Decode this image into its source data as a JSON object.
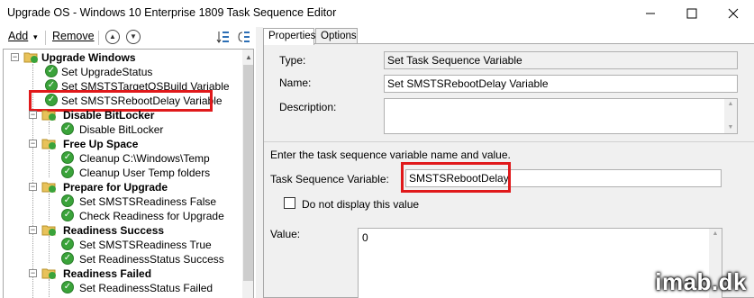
{
  "window": {
    "title": "Upgrade OS - Windows 10 Enterprise 1809 Task Sequence Editor",
    "minimize_icon": "minimize-icon",
    "maximize_icon": "maximize-icon",
    "close_icon": "close-icon"
  },
  "toolbar": {
    "add_label": "Add",
    "add_arrow": "▾",
    "remove_label": "Remove",
    "move_up_icon": "move-up-icon",
    "move_down_icon": "move-down-icon"
  },
  "tree": {
    "items": [
      {
        "label": "Upgrade Windows",
        "type": "group",
        "level": 0
      },
      {
        "label": "Set UpgradeStatus",
        "type": "step",
        "level": 1
      },
      {
        "label": "Set SMSTSTargetOSBuild Variable",
        "type": "step",
        "level": 1
      },
      {
        "label": "Set SMSTSRebootDelay Variable",
        "type": "step",
        "level": 1,
        "selected": true
      },
      {
        "label": "Disable BitLocker",
        "type": "group",
        "level": 1
      },
      {
        "label": "Disable BitLocker",
        "type": "step",
        "level": 2
      },
      {
        "label": "Free Up Space",
        "type": "group",
        "level": 1
      },
      {
        "label": "Cleanup C:\\Windows\\Temp",
        "type": "step",
        "level": 2
      },
      {
        "label": "Cleanup User Temp folders",
        "type": "step",
        "level": 2
      },
      {
        "label": "Prepare for Upgrade",
        "type": "group",
        "level": 1
      },
      {
        "label": "Set SMSTSReadiness False",
        "type": "step",
        "level": 2
      },
      {
        "label": "Check Readiness for Upgrade",
        "type": "step",
        "level": 2
      },
      {
        "label": "Readiness Success",
        "type": "group",
        "level": 1
      },
      {
        "label": "Set SMSTSReadiness True",
        "type": "step",
        "level": 2
      },
      {
        "label": "Set ReadinessStatus Success",
        "type": "step",
        "level": 2
      },
      {
        "label": "Readiness Failed",
        "type": "group",
        "level": 1
      },
      {
        "label": "Set ReadinessStatus Failed",
        "type": "step",
        "level": 2
      }
    ]
  },
  "tabs": [
    {
      "label": "Properties",
      "active": true
    },
    {
      "label": "Options",
      "active": false
    }
  ],
  "properties": {
    "type_label": "Type:",
    "type_value": "Set Task Sequence Variable",
    "name_label": "Name:",
    "name_value": "Set SMSTSRebootDelay Variable",
    "description_label": "Description:",
    "description_value": "",
    "instruction": "Enter the task sequence variable name and value.",
    "variable_label": "Task Sequence Variable:",
    "variable_value": "SMSTSRebootDelay",
    "hide_checkbox_label": "Do not display this value",
    "hide_checkbox_checked": false,
    "value_label": "Value:",
    "value_value": "0"
  },
  "watermark": "imab.dk",
  "colors": {
    "highlight": "#e0191b",
    "check_green": "#3aa33a",
    "folder_yellow": "#e8c25a"
  }
}
